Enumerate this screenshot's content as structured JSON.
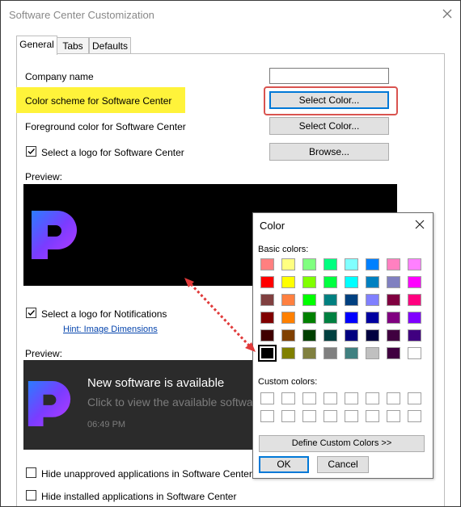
{
  "window": {
    "title": "Software Center Customization"
  },
  "tabs": [
    {
      "label": "General"
    },
    {
      "label": "Tabs"
    },
    {
      "label": "Defaults"
    }
  ],
  "general": {
    "company_name_label": "Company name",
    "company_name_value": "",
    "color_scheme_label": "Color scheme for Software Center",
    "foreground_label": "Foreground color for Software Center",
    "logo_label": "Select a logo for Software Center",
    "select_color_btn": "Select Color...",
    "select_color_btn2": "Select Color...",
    "browse_btn": "Browse...",
    "preview_label": "Preview:",
    "notif_logo_label": "Select a logo for Notifications",
    "hint_link": "Hint: Image Dimensions",
    "preview2_label": "Preview:",
    "notif_title": "New software is available",
    "notif_sub": "Click to view the available software",
    "notif_time": "06:49 PM",
    "hide_unapproved": "Hide unapproved applications in Software Center",
    "hide_installed": "Hide installed applications in Software Center"
  },
  "color_dialog": {
    "title": "Color",
    "basic_label": "Basic colors:",
    "custom_label": "Custom colors:",
    "define_btn": "Define Custom Colors >>",
    "ok_btn": "OK",
    "cancel_btn": "Cancel",
    "basic_colors": [
      "#ff8080",
      "#ffff80",
      "#80ff80",
      "#00ff80",
      "#80ffff",
      "#0080ff",
      "#ff80c0",
      "#ff80ff",
      "#ff0000",
      "#ffff00",
      "#80ff00",
      "#00ff40",
      "#00ffff",
      "#0080c0",
      "#8080c0",
      "#ff00ff",
      "#804040",
      "#ff8040",
      "#00ff00",
      "#008080",
      "#004080",
      "#8080ff",
      "#800040",
      "#ff0080",
      "#800000",
      "#ff8000",
      "#008000",
      "#008040",
      "#0000ff",
      "#0000a0",
      "#800080",
      "#8000ff",
      "#400000",
      "#804000",
      "#004000",
      "#004040",
      "#000080",
      "#000040",
      "#400040",
      "#400080",
      "#000000",
      "#808000",
      "#808040",
      "#808080",
      "#408080",
      "#c0c0c0",
      "#400040",
      "#ffffff"
    ],
    "selected_index": 40
  },
  "colors": {
    "highlight": "#fff33a",
    "annotation_red": "#d9534f",
    "focus_blue": "#0078d7"
  }
}
